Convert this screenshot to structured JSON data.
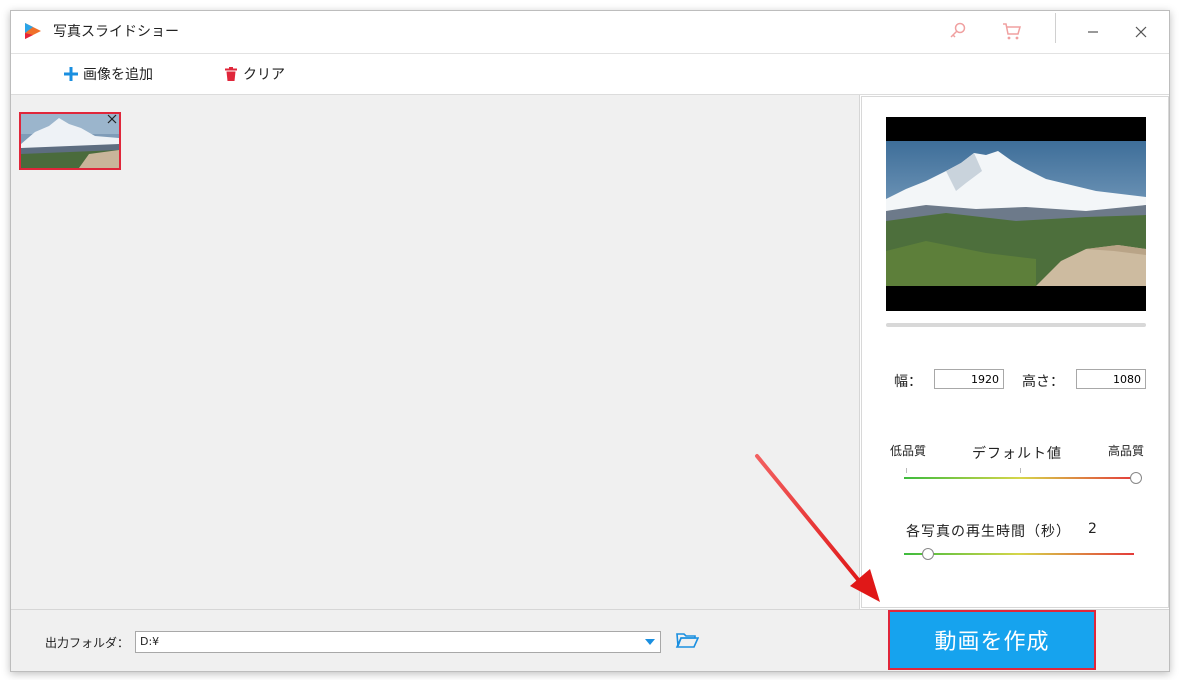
{
  "app": {
    "title": "写真スライドショー",
    "accent": "#16a3ee",
    "highlight": "#e0263a"
  },
  "titlebar": {
    "icons": [
      "key-icon",
      "cart-icon"
    ],
    "minimize_icon": "minimize-icon",
    "close_icon": "close-icon"
  },
  "toolbar": {
    "add_image_label": "画像を追加",
    "clear_label": "クリア"
  },
  "settings": {
    "width_label": "幅：",
    "width_value": "1920",
    "height_label": "高さ：",
    "height_value": "1080",
    "quality_low": "低品質",
    "quality_default": "デフォルト値",
    "quality_high": "高品質",
    "quality_level": 1.0,
    "duration_label": "各写真の再生時間（秒）",
    "duration_value": "2"
  },
  "output": {
    "folder_label": "出力フォルダ：",
    "folder_value": "D:¥"
  },
  "actions": {
    "create_label": "動画を作成"
  }
}
